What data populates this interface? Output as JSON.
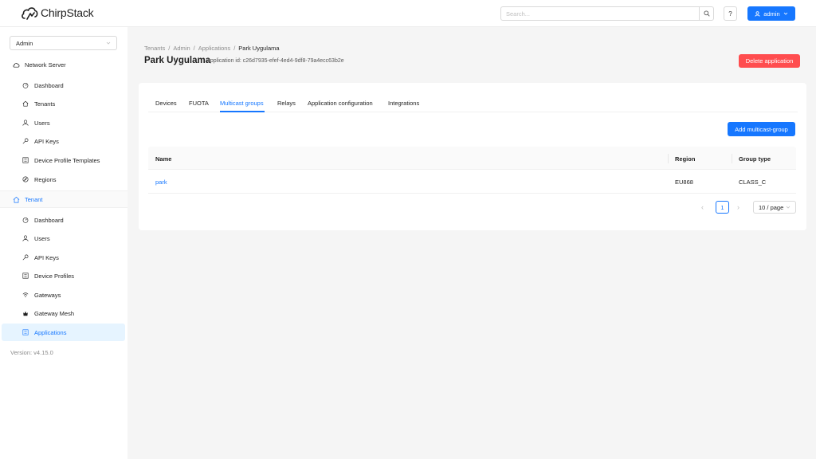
{
  "app": {
    "name": "ChirpStack"
  },
  "header": {
    "search_placeholder": "Search...",
    "help_label": "?",
    "user_label": "admin"
  },
  "sidebar": {
    "org_select": "Admin",
    "network_server": {
      "label": "Network Server",
      "items": [
        {
          "label": "Dashboard",
          "icon": "dashboard-icon"
        },
        {
          "label": "Tenants",
          "icon": "home-icon"
        },
        {
          "label": "Users",
          "icon": "user-icon"
        },
        {
          "label": "API Keys",
          "icon": "key-icon"
        },
        {
          "label": "Device Profile Templates",
          "icon": "profile-icon"
        },
        {
          "label": "Regions",
          "icon": "compass-icon"
        }
      ]
    },
    "tenant": {
      "label": "Tenant",
      "items": [
        {
          "label": "Dashboard",
          "icon": "dashboard-icon"
        },
        {
          "label": "Users",
          "icon": "user-icon"
        },
        {
          "label": "API Keys",
          "icon": "key-icon"
        },
        {
          "label": "Device Profiles",
          "icon": "profile-icon"
        },
        {
          "label": "Gateways",
          "icon": "wifi-icon"
        },
        {
          "label": "Gateway Mesh",
          "icon": "mesh-icon"
        },
        {
          "label": "Applications",
          "icon": "applications-icon",
          "active": true
        }
      ]
    },
    "version": "Version: v4.15.0"
  },
  "breadcrumb": [
    "Tenants",
    "Admin",
    "Applications",
    "Park Uygulama"
  ],
  "page": {
    "title": "Park Uygulama",
    "subtitle": "application id: c26d7935-efef-4ed4-9df8-79a4ecc63b2e",
    "delete_label": "Delete application"
  },
  "tabs": [
    "Devices",
    "FUOTA",
    "Multicast groups",
    "Relays",
    "Application configuration",
    "Integrations"
  ],
  "active_tab": "Multicast groups",
  "add_button_label": "Add multicast-group",
  "table": {
    "columns": [
      "Name",
      "Region",
      "Group type"
    ],
    "rows": [
      {
        "name": "park",
        "region": "EU868",
        "group_type": "CLASS_C"
      }
    ]
  },
  "pagination": {
    "current": "1",
    "page_size": "10 / page"
  },
  "colors": {
    "primary": "#1677ff",
    "danger": "#ff4d4f"
  }
}
